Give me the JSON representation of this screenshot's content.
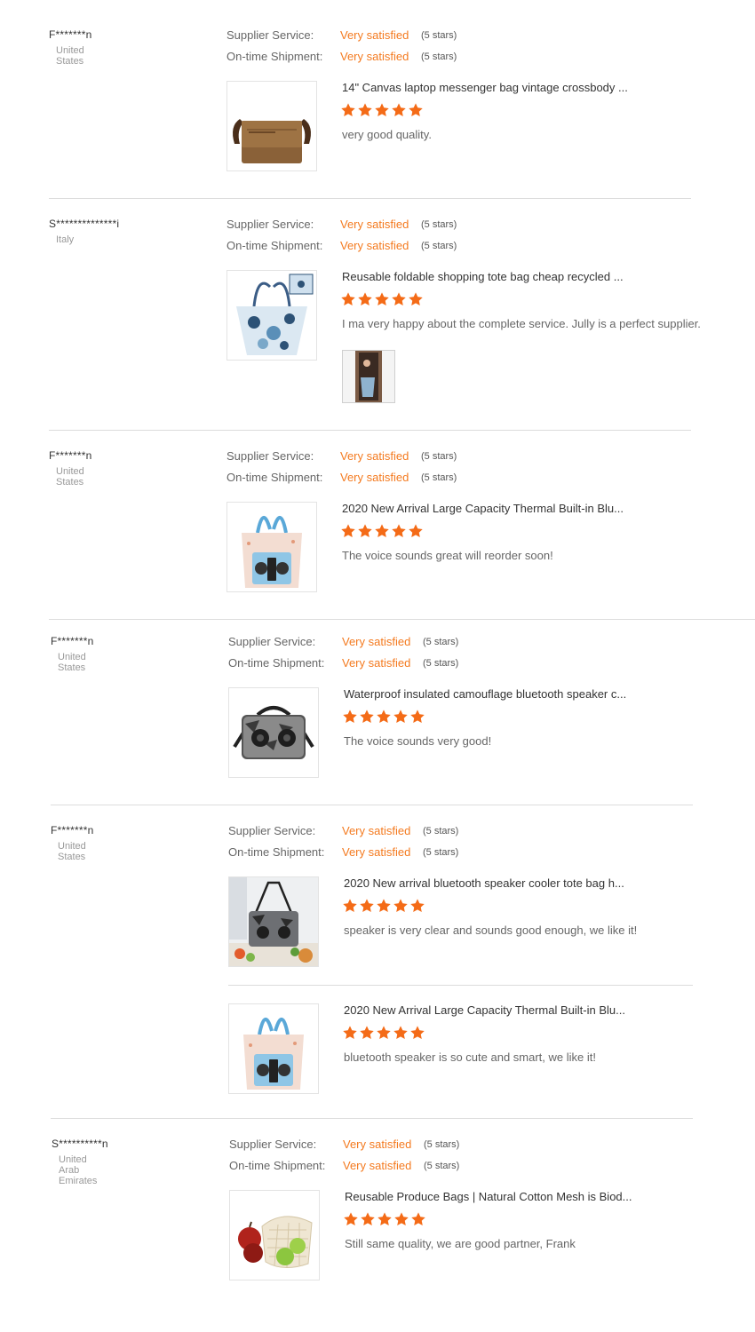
{
  "labels": {
    "supplier_service": "Supplier Service:",
    "on_time_shipment": "On-time Shipment:"
  },
  "colors": {
    "accent": "#f47a1f",
    "star": "#f46b17"
  },
  "reviews": [
    {
      "user": "F*******n",
      "country": "United States",
      "supplier_service": {
        "value": "Very satisfied",
        "stars": "(5 stars)"
      },
      "on_time_shipment": {
        "value": "Very satisfied",
        "stars": "(5 stars)"
      },
      "products": [
        {
          "title": "14\" Canvas laptop messenger bag vintage crossbody ...",
          "rating": 5,
          "comment": "very good quality.",
          "image_icon": "messenger-bag-icon"
        }
      ]
    },
    {
      "user": "S**************i",
      "country": "Italy",
      "supplier_service": {
        "value": "Very satisfied",
        "stars": "(5 stars)"
      },
      "on_time_shipment": {
        "value": "Very satisfied",
        "stars": "(5 stars)"
      },
      "products": [
        {
          "title": "Reusable foldable shopping tote bag cheap recycled ...",
          "rating": 5,
          "comment": "I ma very happy about the complete service. Jully is a perfect supplier.",
          "image_icon": "tote-bag-icon"
        }
      ]
    },
    {
      "user": "F*******n",
      "country": "United States",
      "supplier_service": {
        "value": "Very satisfied",
        "stars": "(5 stars)"
      },
      "on_time_shipment": {
        "value": "Very satisfied",
        "stars": "(5 stars)"
      },
      "products": [
        {
          "title": "2020 New Arrival Large Capacity Thermal Built-in Blu...",
          "rating": 5,
          "comment": "The voice sounds great will reorder soon!",
          "image_icon": "speaker-tote-icon"
        }
      ]
    },
    {
      "user": "F*******n",
      "country": "United States",
      "supplier_service": {
        "value": "Very satisfied",
        "stars": "(5 stars)"
      },
      "on_time_shipment": {
        "value": "Very satisfied",
        "stars": "(5 stars)"
      },
      "products": [
        {
          "title": "Waterproof insulated camouflage bluetooth speaker c...",
          "rating": 5,
          "comment": "The voice sounds very good!",
          "image_icon": "speaker-cooler-icon"
        }
      ]
    },
    {
      "user": "F*******n",
      "country": "United States",
      "supplier_service": {
        "value": "Very satisfied",
        "stars": "(5 stars)"
      },
      "on_time_shipment": {
        "value": "Very satisfied",
        "stars": "(5 stars)"
      },
      "products": [
        {
          "title": "2020 New arrival bluetooth speaker cooler tote bag h...",
          "rating": 5,
          "comment": "speaker is very clear and sounds good enough, we like it!",
          "image_icon": "cooler-tote-icon"
        },
        {
          "title": "2020 New Arrival Large Capacity Thermal Built-in Blu...",
          "rating": 5,
          "comment": "bluetooth speaker is so cute and smart, we like it!",
          "image_icon": "speaker-tote-icon"
        }
      ]
    },
    {
      "user": "S**********n",
      "country": "United Arab Emirates",
      "supplier_service": {
        "value": "Very satisfied",
        "stars": "(5 stars)"
      },
      "on_time_shipment": {
        "value": "Very satisfied",
        "stars": "(5 stars)"
      },
      "products": [
        {
          "title": "Reusable Produce Bags | Natural Cotton Mesh is Biod...",
          "rating": 5,
          "comment": "Still same quality, we are good partner, Frank",
          "image_icon": "produce-bag-icon"
        }
      ]
    }
  ]
}
